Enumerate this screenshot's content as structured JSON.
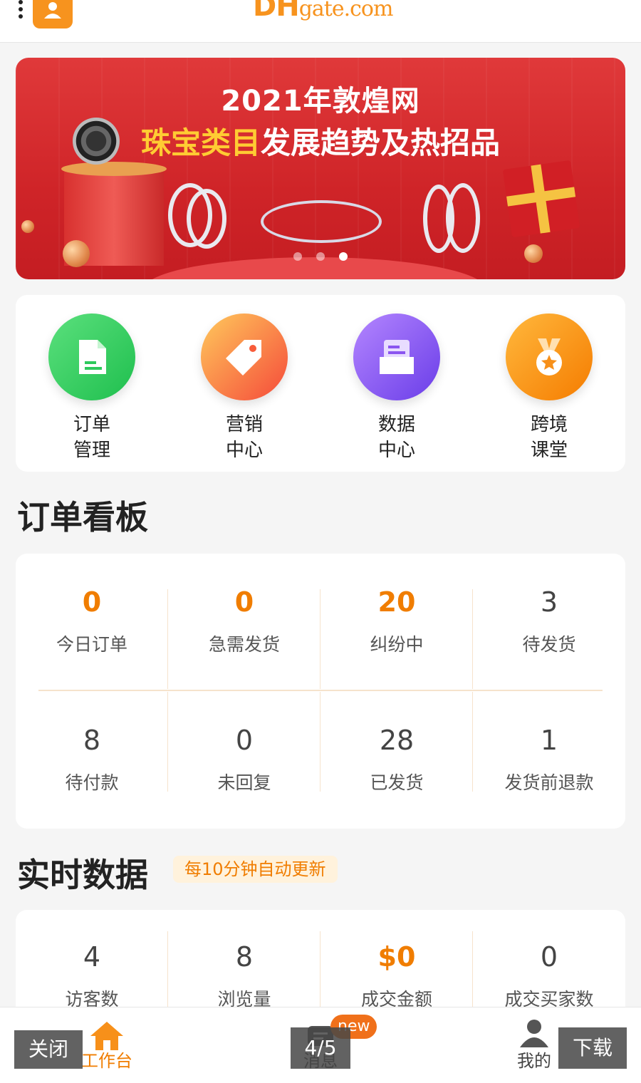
{
  "header": {
    "logo_bold": "DH",
    "logo_rest": "gate",
    "logo_domain": ".com"
  },
  "banner": {
    "title_line1": "2021年敦煌网",
    "title_line2_highlight": "珠宝类目",
    "title_line2_rest": "发展趋势及热招品",
    "slides_total": 3,
    "active_slide": 3
  },
  "quick_menu": [
    {
      "label_line1": "订单",
      "label_line2": "管理",
      "icon": "order-document-icon"
    },
    {
      "label_line1": "营销",
      "label_line2": "中心",
      "icon": "tag-icon"
    },
    {
      "label_line1": "数据",
      "label_line2": "中心",
      "icon": "inbox-tray-icon"
    },
    {
      "label_line1": "跨境",
      "label_line2": "课堂",
      "icon": "medal-star-icon"
    }
  ],
  "order_board": {
    "title": "订单看板",
    "stats": [
      {
        "value": "0",
        "label": "今日订单"
      },
      {
        "value": "0",
        "label": "急需发货"
      },
      {
        "value": "20",
        "label": "纠纷中"
      },
      {
        "value": "3",
        "label": "待发货"
      },
      {
        "value": "8",
        "label": "待付款"
      },
      {
        "value": "0",
        "label": "未回复"
      },
      {
        "value": "28",
        "label": "已发货"
      },
      {
        "value": "1",
        "label": "发货前退款"
      }
    ]
  },
  "realtime": {
    "title": "实时数据",
    "badge": "每10分钟自动更新",
    "stats": [
      {
        "value": "4",
        "label": "访客数"
      },
      {
        "value": "8",
        "label": "浏览量"
      },
      {
        "value": "$0",
        "label": "成交金额"
      },
      {
        "value": "0",
        "label": "成交买家数"
      }
    ]
  },
  "bottom_nav": {
    "workbench": "工作台",
    "messages": "消息",
    "new_badge": "new",
    "mine": "我的"
  },
  "overlay": {
    "close": "关闭",
    "page_indicator": "4/5",
    "download": "下载"
  },
  "colors": {
    "accent": "#f07d00",
    "banner_red": "#d6282c",
    "order_icon": "#2ec95c",
    "marketing_icon": "#f85c3a",
    "data_icon": "#8b55f0",
    "course_icon": "#f7901a"
  }
}
